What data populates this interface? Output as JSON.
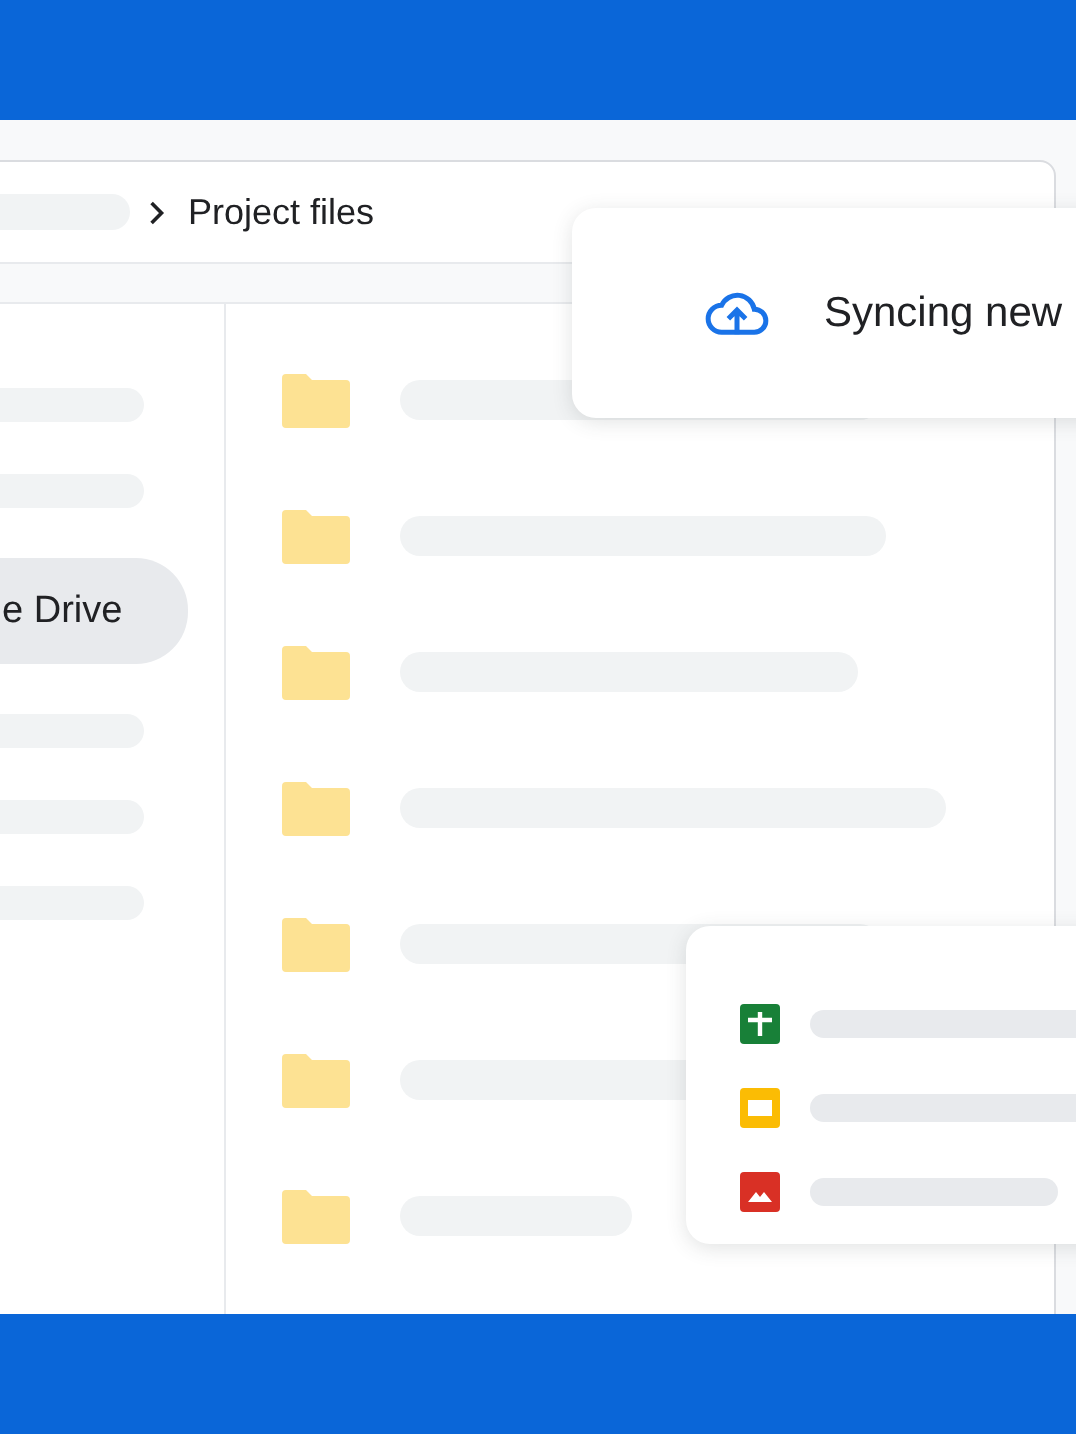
{
  "breadcrumb": {
    "current": "Project files"
  },
  "sidebar": {
    "items": [
      {
        "kind": "placeholder",
        "selected": false
      },
      {
        "kind": "placeholder",
        "selected": false
      },
      {
        "kind": "item",
        "label": "e Drive",
        "selected": true
      },
      {
        "kind": "placeholder",
        "selected": false
      },
      {
        "kind": "placeholder",
        "selected": false
      },
      {
        "kind": "placeholder",
        "selected": false
      }
    ]
  },
  "file_list": {
    "rows": [
      {
        "kind": "folder"
      },
      {
        "kind": "folder"
      },
      {
        "kind": "folder"
      },
      {
        "kind": "folder"
      },
      {
        "kind": "folder"
      },
      {
        "kind": "folder"
      },
      {
        "kind": "folder"
      }
    ]
  },
  "sync_toast": {
    "text": "Syncing new"
  },
  "file_card": {
    "rows": [
      {
        "kind": "sheet"
      },
      {
        "kind": "slides"
      },
      {
        "kind": "image"
      }
    ]
  }
}
